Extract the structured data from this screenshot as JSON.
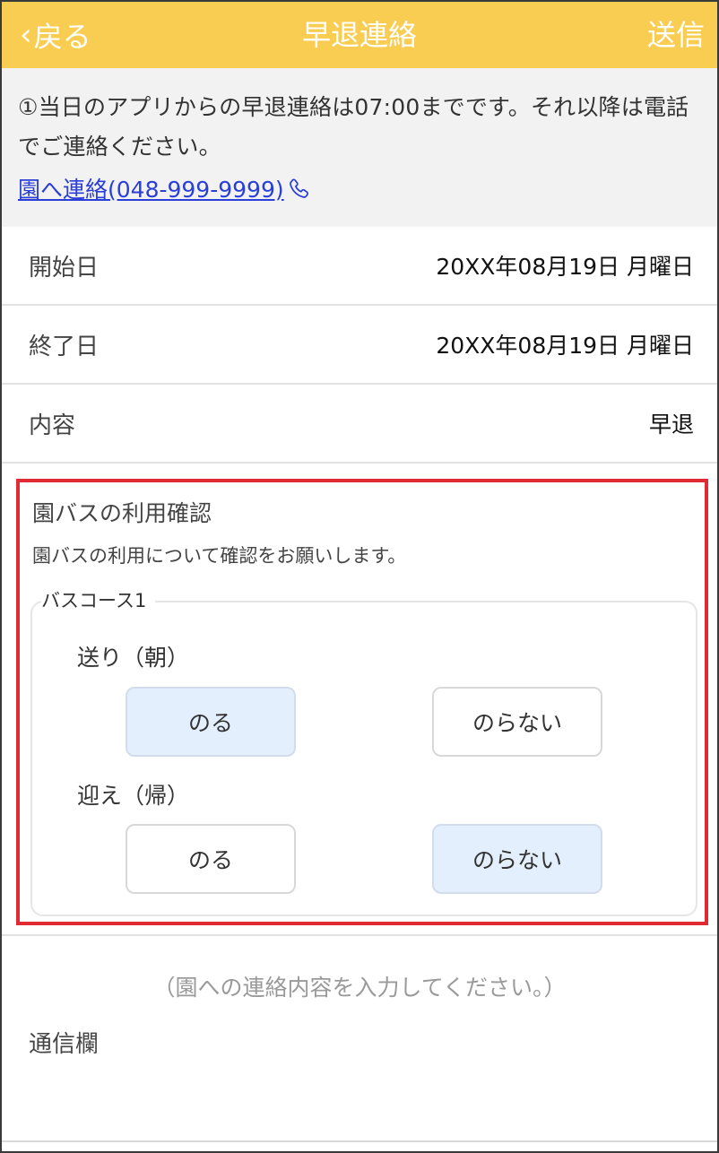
{
  "header": {
    "back_label": "戻る",
    "title": "早退連絡",
    "send_label": "送信"
  },
  "notice": {
    "text": "①当日のアプリからの早退連絡は07:00までです。それ以降は電話でご連絡ください。",
    "link_label": "園へ連絡(048-999-9999)"
  },
  "fields": {
    "start_date": {
      "label": "開始日",
      "value": "20XX年08月19日 月曜日"
    },
    "end_date": {
      "label": "終了日",
      "value": "20XX年08月19日 月曜日"
    },
    "content": {
      "label": "内容",
      "value": "早退"
    }
  },
  "bus": {
    "title": "園バスの利用確認",
    "description": "園バスの利用について確認をお願いします。",
    "course_label": "バスコース1",
    "send_off": {
      "label": "送り（朝）",
      "options": [
        "のる",
        "のらない"
      ],
      "selected": "のる"
    },
    "pick_up": {
      "label": "迎え（帰）",
      "options": [
        "のる",
        "のらない"
      ],
      "selected": "のらない"
    }
  },
  "memo": {
    "placeholder": "（園への連絡内容を入力してください。）",
    "label": "通信欄"
  },
  "colors": {
    "header_bg": "#f9cd52",
    "highlight_border": "#e02b35",
    "selected_bg": "#e4effd",
    "link": "#2a3fd6"
  }
}
